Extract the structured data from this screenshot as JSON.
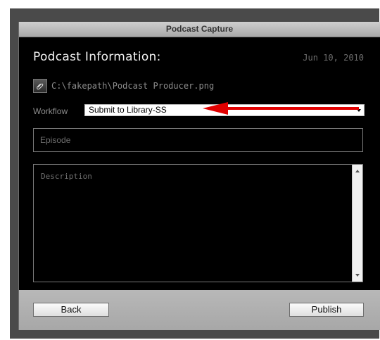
{
  "window": {
    "title": "Podcast Capture"
  },
  "form": {
    "heading": "Podcast Information:",
    "date": "Jun 10, 2010",
    "attachment_path": "C:\\fakepath\\Podcast Producer.png",
    "workflow_label": "Workflow",
    "workflow_value": "Submit to Library-SS",
    "episode_placeholder": "Episode",
    "description_placeholder": "Description"
  },
  "buttons": {
    "back": "Back",
    "publish": "Publish"
  },
  "icons": {
    "attachment": "paperclip-icon",
    "dropdown": "chevron-down-icon"
  },
  "colors": {
    "annotation_arrow": "#e00000"
  }
}
